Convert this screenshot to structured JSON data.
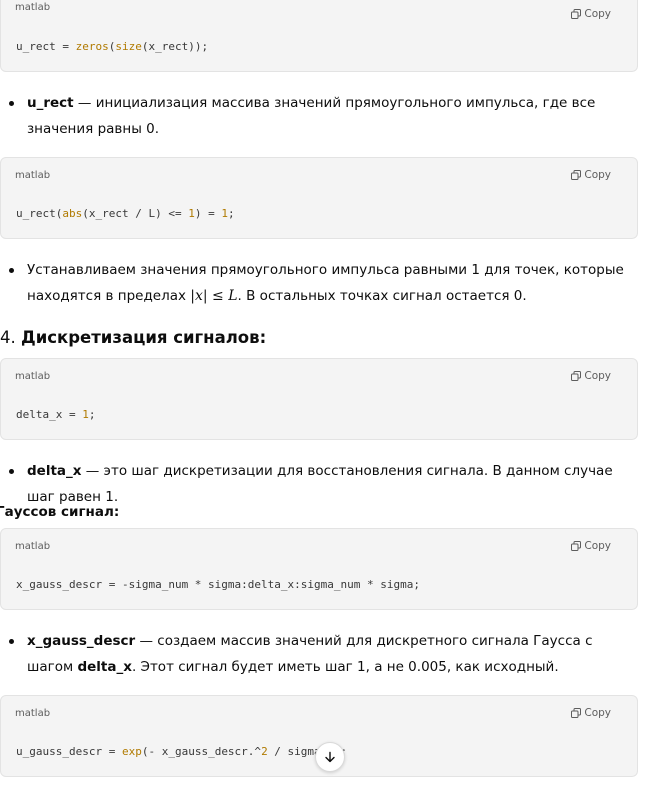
{
  "blocks": [
    {
      "lang": "matlab",
      "copy": "Copy"
    },
    {
      "lang": "matlab",
      "copy": "Copy"
    },
    {
      "lang": "matlab",
      "copy": "Copy"
    },
    {
      "lang": "matlab",
      "copy": "Copy"
    },
    {
      "lang": "matlab",
      "copy": "Copy"
    }
  ],
  "code": {
    "c1": [
      "u_rect = ",
      "zeros",
      "(",
      "size",
      "(x_rect));"
    ],
    "c2": [
      "u_rect(",
      "abs",
      "(x_rect / L) <= ",
      "1",
      ") = ",
      "1",
      ";"
    ],
    "c3": [
      "delta_x = ",
      "1",
      ";"
    ],
    "c4": [
      "x_gauss_descr = -sigma_num * sigma:delta_x:sigma_num * sigma;"
    ],
    "c5": [
      "u_gauss_descr = ",
      "exp",
      "(- x_gauss_descr.^",
      "2",
      " / sigm",
      "a^2",
      ");"
    ]
  },
  "bullets": {
    "b1_term": "u_rect",
    "b1_text": " — инициализация массива значений прямоугольного импульса, где все значения равны 0.",
    "b2_text_a": "Устанавливаем значения прямоугольного импульса равными 1 для точек, которые находятся в пределах ",
    "b2_math": "|x| ≤ L",
    "b2_text_b": ". В остальных точках сигнал остается 0.",
    "b3_term": "delta_x",
    "b3_text": " — это шаг дискретизации для восстановления сигнала. В данном случае шаг равен 1.",
    "b4_term": "x_gauss_descr",
    "b4_text_a": " — создаем массив значений для дискретного сигнала Гаусса с шагом ",
    "b4_term2": "delta_x",
    "b4_text_b": ". Этот сигнал будет иметь шаг 1, а не 0.005, как исходный."
  },
  "headings": {
    "h4_num": "4. ",
    "h4_text": "Дискретизация сигналов:",
    "gauss": "Гауссов сигнал:"
  },
  "icons": {
    "copy": "copy-icon",
    "scroll": "arrow-down-icon"
  }
}
